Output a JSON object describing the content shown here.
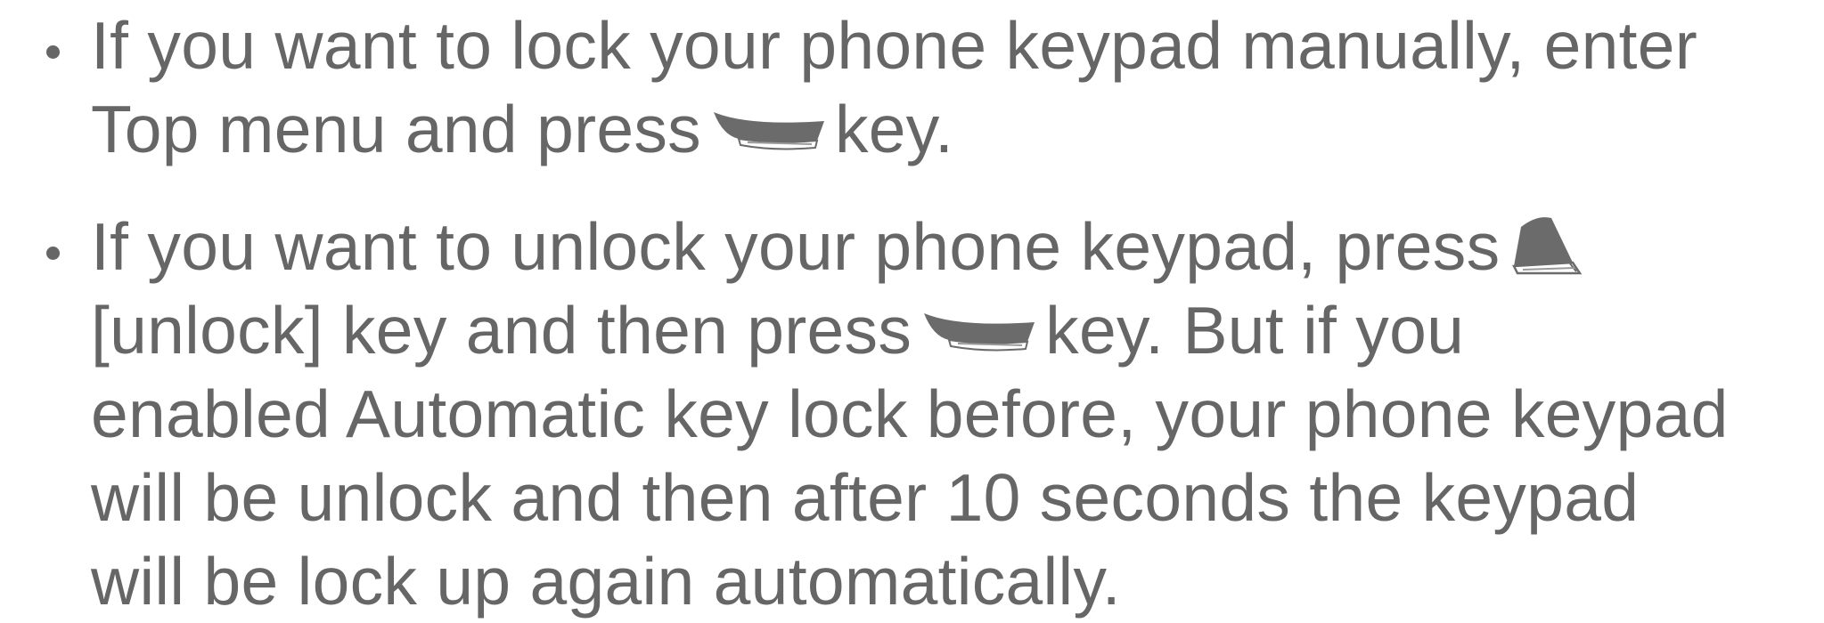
{
  "bullets": [
    {
      "lines": [
        "If you want to lock your phone keypad manually, enter",
        "Top menu and press",
        "key."
      ]
    },
    {
      "lines": [
        "If you want to unlock your phone keypad, press",
        "[unlock] key and then press",
        "key. But if you",
        "enabled Automatic key lock before, your phone keypad",
        "will be unlock and then after 10 seconds the keypad",
        "will be lock up again automatically."
      ]
    }
  ],
  "icons": {
    "softkey": "right-soft-key-icon",
    "unlock_key": "star-key-icon"
  },
  "colors": {
    "text": "#666666",
    "icon_fill": "#6b6b6b"
  }
}
